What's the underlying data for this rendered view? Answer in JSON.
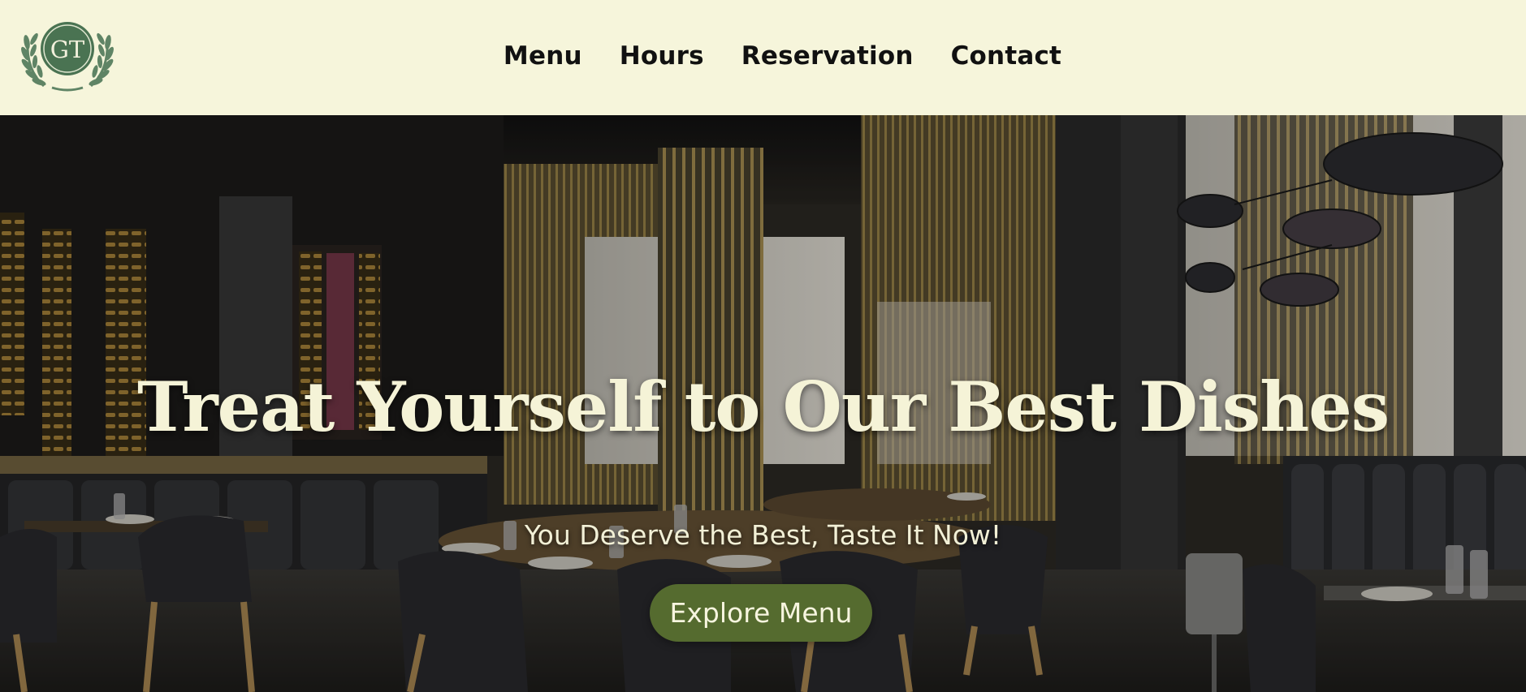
{
  "brand": {
    "logo_text": "GT",
    "logo_color": "#4a7352",
    "logo_laurel_color": "#5f8465"
  },
  "nav": {
    "items": [
      {
        "label": "Menu"
      },
      {
        "label": "Hours"
      },
      {
        "label": "Reservation"
      },
      {
        "label": "Contact"
      }
    ]
  },
  "hero": {
    "title": "Treat Yourself to Our Best Dishes",
    "subtitle": "You Deserve the Best, Taste It Now!",
    "cta_label": "Explore Menu"
  },
  "colors": {
    "header_bg": "#f6f5db",
    "cta_bg": "#556b2f",
    "hero_text": "#f5f3d7"
  }
}
